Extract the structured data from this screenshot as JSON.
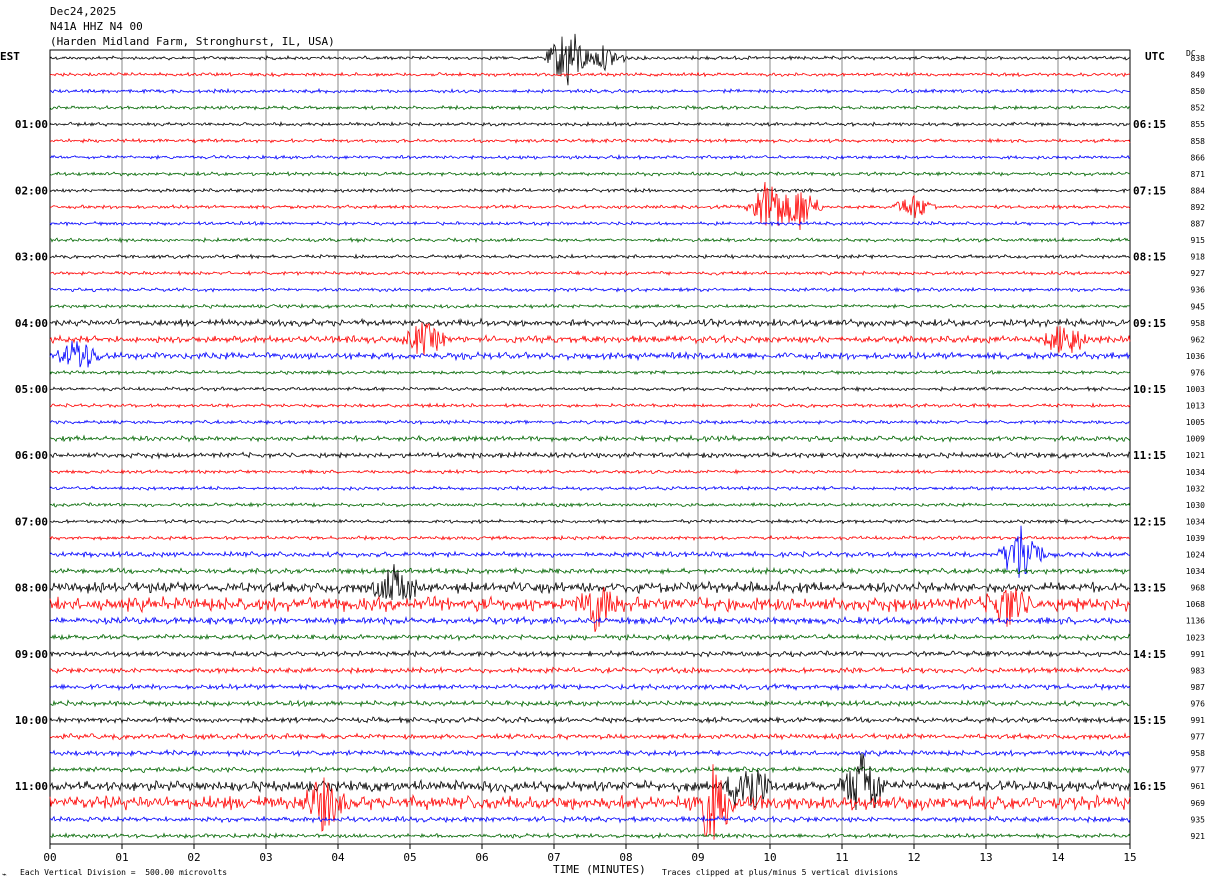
{
  "header": {
    "date": "Dec24,2025",
    "station": "N41A HHZ N4 00",
    "location": "(Harden Midland Farm, Stronghurst, IL, USA)"
  },
  "left_tz": "EST",
  "right_tz": "UTC",
  "dc_label": "DC",
  "footer": {
    "scale_note": "Each Vertical Division =  500.00 microvolts",
    "xlabel": "TIME (MINUTES)",
    "clip_note": "Traces clipped at plus/minus 5 vertical divisions"
  },
  "colors": {
    "trace_cycle": [
      "#000000",
      "#ff0000",
      "#0000ff",
      "#006600"
    ],
    "grid": "#000000"
  },
  "chart_data": {
    "type": "line",
    "title": "Dec24,2025 N41A HHZ N4 00 (Harden Midland Farm, Stronghurst, IL, USA)",
    "xlabel": "TIME (MINUTES)",
    "x_ticks": [
      "00",
      "01",
      "02",
      "03",
      "04",
      "05",
      "06",
      "07",
      "08",
      "09",
      "10",
      "11",
      "12",
      "13",
      "14",
      "15"
    ],
    "xlim": [
      0,
      15
    ],
    "trace_count": 48,
    "minutes_per_trace": 15,
    "left_hour_labels": [
      "01:00",
      "02:00",
      "03:00",
      "04:00",
      "05:00",
      "06:00",
      "07:00",
      "08:00",
      "09:00",
      "10:00",
      "11:00"
    ],
    "right_hour_labels": [
      "06:15",
      "07:15",
      "08:15",
      "09:15",
      "10:15",
      "11:15",
      "12:15",
      "13:15",
      "14:15",
      "15:15",
      "16:15"
    ],
    "dc_offsets": [
      838,
      849,
      850,
      852,
      855,
      858,
      866,
      871,
      884,
      892,
      887,
      915,
      918,
      927,
      936,
      945,
      958,
      962,
      1036,
      976,
      1003,
      1013,
      1005,
      1009,
      1021,
      1034,
      1032,
      1030,
      1034,
      1039,
      1024,
      1034,
      968,
      1068,
      1136,
      1023,
      991,
      983,
      987,
      976,
      991,
      977,
      958,
      977,
      961,
      969,
      935,
      921
    ],
    "trace_amplitude": [
      1,
      1,
      1,
      1,
      1,
      1,
      1,
      1,
      1,
      1,
      1,
      1,
      1,
      1,
      1,
      1,
      2,
      2,
      2,
      1,
      1,
      1,
      1,
      1.5,
      1.5,
      1,
      1,
      1,
      1,
      1,
      1.5,
      1.5,
      3,
      4,
      2,
      1.5,
      1.5,
      1.5,
      1.5,
      1.5,
      1.5,
      1.5,
      1.5,
      1.5,
      3,
      4,
      1.5,
      1.2
    ],
    "events": [
      {
        "trace": 0,
        "minute": 7.2,
        "amp": 8
      },
      {
        "trace": 0,
        "minute": 7.7,
        "amp": 3
      },
      {
        "trace": 9,
        "minute": 10.0,
        "amp": 8
      },
      {
        "trace": 9,
        "minute": 10.4,
        "amp": 6
      },
      {
        "trace": 9,
        "minute": 12.0,
        "amp": 3
      },
      {
        "trace": 17,
        "minute": 5.2,
        "amp": 4
      },
      {
        "trace": 17,
        "minute": 14.1,
        "amp": 4
      },
      {
        "trace": 18,
        "minute": 0.4,
        "amp": 4
      },
      {
        "trace": 30,
        "minute": 13.5,
        "amp": 8
      },
      {
        "trace": 32,
        "minute": 4.8,
        "amp": 5
      },
      {
        "trace": 33,
        "minute": 7.6,
        "amp": 6
      },
      {
        "trace": 33,
        "minute": 13.3,
        "amp": 5
      },
      {
        "trace": 44,
        "minute": 9.7,
        "amp": 8
      },
      {
        "trace": 44,
        "minute": 11.3,
        "amp": 9
      },
      {
        "trace": 45,
        "minute": 9.2,
        "amp": 9
      },
      {
        "trace": 45,
        "minute": 3.8,
        "amp": 6
      }
    ]
  }
}
